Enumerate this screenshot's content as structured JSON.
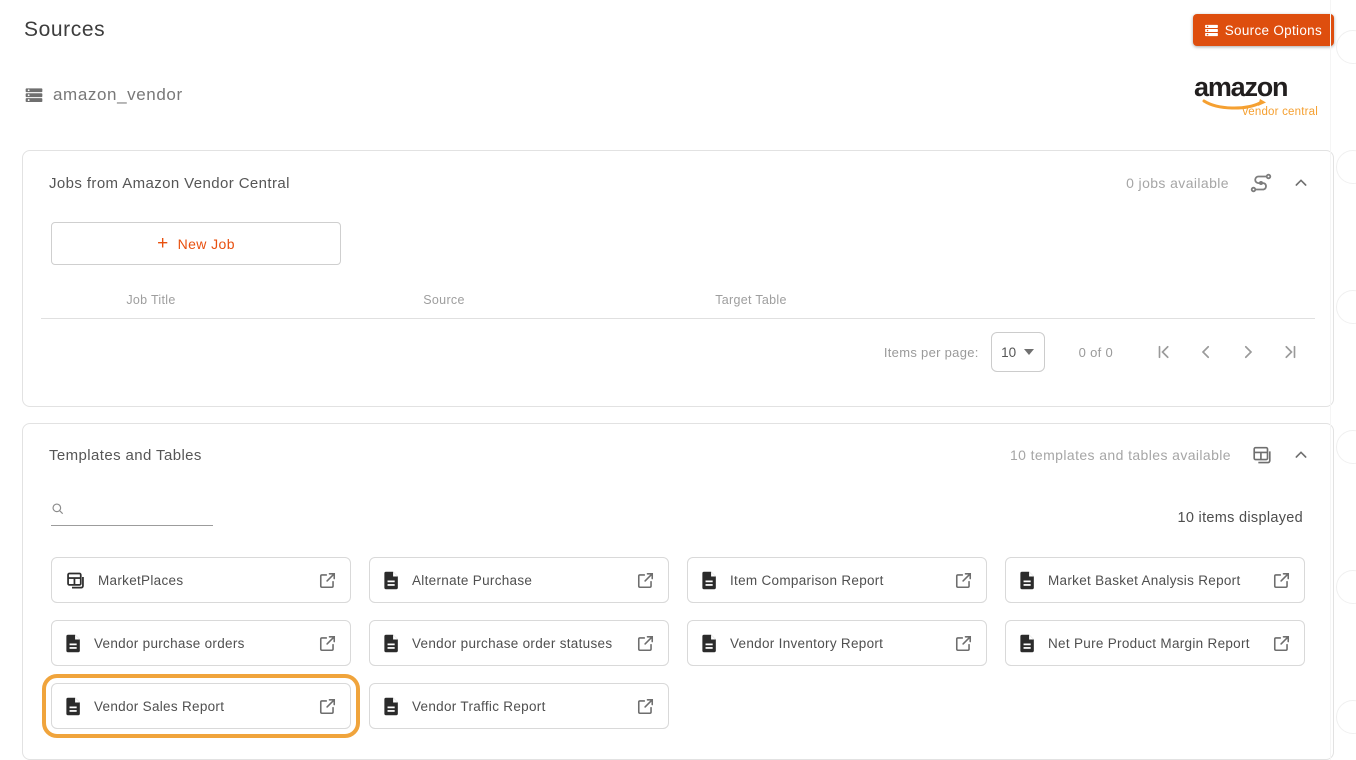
{
  "page": {
    "title": "Sources"
  },
  "header": {
    "source_options_label": "Source Options"
  },
  "source": {
    "name": "amazon_vendor"
  },
  "brand": {
    "word": "amazon",
    "sub": "vendor central"
  },
  "jobs_panel": {
    "title": "Jobs from Amazon Vendor Central",
    "availability": "0 jobs available",
    "new_job_label": "New Job",
    "new_job_plus": "+",
    "columns": [
      "Job Title",
      "Source",
      "Target Table"
    ],
    "pagination": {
      "items_per_page_label": "Items per page:",
      "page_size": "10",
      "range": "0 of 0"
    }
  },
  "templates_panel": {
    "title": "Templates and Tables",
    "availability": "10 templates and tables available",
    "items_displayed": "10 items displayed",
    "search_value": "",
    "cards": [
      {
        "label": "MarketPlaces",
        "icon": "table",
        "highlighted": false
      },
      {
        "label": "Alternate Purchase",
        "icon": "document",
        "highlighted": false
      },
      {
        "label": "Item Comparison Report",
        "icon": "document",
        "highlighted": false
      },
      {
        "label": "Market Basket Analysis Report",
        "icon": "document",
        "highlighted": false
      },
      {
        "label": "Vendor purchase orders",
        "icon": "document",
        "highlighted": false
      },
      {
        "label": "Vendor purchase order statuses",
        "icon": "document",
        "highlighted": false
      },
      {
        "label": "Vendor Inventory Report",
        "icon": "document",
        "highlighted": false
      },
      {
        "label": "Net Pure Product Margin Report",
        "icon": "document",
        "highlighted": false
      },
      {
        "label": "Vendor Sales Report",
        "icon": "document",
        "highlighted": true
      },
      {
        "label": "Vendor Traffic Report",
        "icon": "document",
        "highlighted": false
      }
    ]
  },
  "colors": {
    "accent_orange": "#DE4E0E",
    "highlight_orange": "#F0A43C",
    "amazon_orange": "#F5A031"
  }
}
